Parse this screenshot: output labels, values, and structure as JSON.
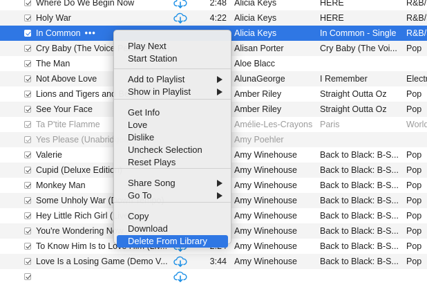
{
  "colors": {
    "selection": "#2f77e4",
    "cloud_icon": "#1b8fe6",
    "menu_bg": "#ececec"
  },
  "tracks": [
    {
      "name": "Where Do We Begin Now",
      "time": "2:48",
      "artist": "Alicia Keys",
      "album": "HERE",
      "genre": "R&B/Soul",
      "cloud": true,
      "style": ""
    },
    {
      "name": "Holy War",
      "time": "4:22",
      "artist": "Alicia Keys",
      "album": "HERE",
      "genre": "R&B/Soul",
      "cloud": true,
      "style": "alt"
    },
    {
      "name": "In Common",
      "more": "•••",
      "time": "",
      "artist": "Alicia Keys",
      "album": "In Common - Single",
      "genre": "R&B/Soul",
      "cloud": false,
      "style": "selected"
    },
    {
      "name": "Cry Baby (The Voice Performance)",
      "time": "",
      "artist": "Alisan Porter",
      "album": "Cry Baby (The Voi...",
      "genre": "Pop",
      "cloud": false,
      "style": "alt"
    },
    {
      "name": "The Man",
      "time": "",
      "artist": "Aloe Blacc",
      "album": "",
      "genre": "",
      "cloud": false,
      "style": ""
    },
    {
      "name": "Not Above Love",
      "time": "",
      "artist": "AlunaGeorge",
      "album": "I Remember",
      "genre": "Electronic",
      "cloud": false,
      "style": "alt"
    },
    {
      "name": "Lions and Tigers and Bears",
      "time": "",
      "artist": "Amber Riley",
      "album": "Straight Outta Oz",
      "genre": "Pop",
      "cloud": false,
      "style": ""
    },
    {
      "name": "See Your Face",
      "time": "",
      "artist": "Amber Riley",
      "album": "Straight Outta Oz",
      "genre": "Pop",
      "cloud": false,
      "style": "alt"
    },
    {
      "name": "Ta P'tite Flamme",
      "time": "",
      "artist": "Amélie-Les-Crayons",
      "album": "Paris",
      "genre": "World",
      "cloud": false,
      "style": "dim"
    },
    {
      "name": "Yes Please (Unabridged)",
      "time": "",
      "artist": "Amy Poehler",
      "album": "",
      "genre": "",
      "cloud": false,
      "style": "alt dim"
    },
    {
      "name": "Valerie",
      "time": "",
      "artist": "Amy Winehouse",
      "album": "Back to Black: B-S...",
      "genre": "Pop",
      "cloud": false,
      "style": ""
    },
    {
      "name": "Cupid (Deluxe Edition)",
      "time": "",
      "artist": "Amy Winehouse",
      "album": "Back to Black: B-S...",
      "genre": "Pop",
      "cloud": false,
      "style": "alt"
    },
    {
      "name": "Monkey Man",
      "time": "",
      "artist": "Amy Winehouse",
      "album": "Back to Black: B-S...",
      "genre": "Pop",
      "cloud": false,
      "style": ""
    },
    {
      "name": "Some Unholy War (Down Tempo)",
      "time": "",
      "artist": "Amy Winehouse",
      "album": "Back to Black: B-S...",
      "genre": "Pop",
      "cloud": false,
      "style": "alt"
    },
    {
      "name": "Hey Little Rich Girl (Live)",
      "time": "",
      "artist": "Amy Winehouse",
      "album": "Back to Black: B-S...",
      "genre": "Pop",
      "cloud": false,
      "style": ""
    },
    {
      "name": "You're Wondering Now",
      "time": "",
      "artist": "Amy Winehouse",
      "album": "Back to Black: B-S...",
      "genre": "Pop",
      "cloud": false,
      "style": "alt"
    },
    {
      "name": "To Know Him Is to Love Him (Liv...",
      "time": "2:24",
      "artist": "Amy Winehouse",
      "album": "Back to Black: B-S...",
      "genre": "Pop",
      "cloud": true,
      "style": ""
    },
    {
      "name": "Love Is a Losing Game (Demo V...",
      "time": "3:44",
      "artist": "Amy Winehouse",
      "album": "Back to Black: B-S...",
      "genre": "Pop",
      "cloud": true,
      "style": "alt"
    },
    {
      "name": "",
      "time": "",
      "artist": "",
      "album": "",
      "genre": "",
      "cloud": true,
      "style": ""
    }
  ],
  "context_menu": {
    "groups": [
      [
        {
          "label": "Play Next"
        },
        {
          "label": "Start Station"
        }
      ],
      [
        {
          "label": "Add to Playlist",
          "submenu": true
        },
        {
          "label": "Show in Playlist",
          "submenu": true
        }
      ],
      [
        {
          "label": "Get Info"
        },
        {
          "label": "Love"
        },
        {
          "label": "Dislike"
        },
        {
          "label": "Uncheck Selection"
        },
        {
          "label": "Reset Plays"
        }
      ],
      [
        {
          "label": "Share Song",
          "submenu": true
        },
        {
          "label": "Go To",
          "submenu": true
        }
      ],
      [
        {
          "label": "Copy"
        },
        {
          "label": "Download"
        },
        {
          "label": "Delete From Library",
          "active": true
        }
      ]
    ]
  }
}
